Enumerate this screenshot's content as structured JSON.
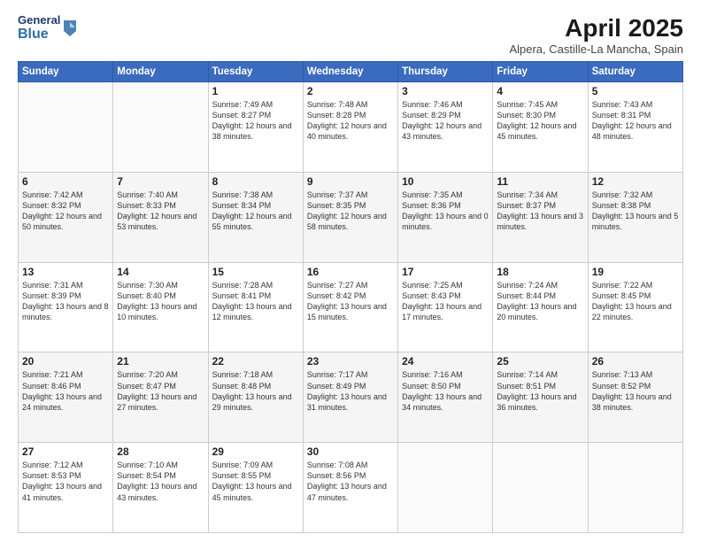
{
  "header": {
    "logo_general": "General",
    "logo_blue": "Blue",
    "month_year": "April 2025",
    "location": "Alpera, Castille-La Mancha, Spain"
  },
  "days_of_week": [
    "Sunday",
    "Monday",
    "Tuesday",
    "Wednesday",
    "Thursday",
    "Friday",
    "Saturday"
  ],
  "weeks": [
    [
      {
        "day": "",
        "info": ""
      },
      {
        "day": "",
        "info": ""
      },
      {
        "day": "1",
        "info": "Sunrise: 7:49 AM\nSunset: 8:27 PM\nDaylight: 12 hours and 38 minutes."
      },
      {
        "day": "2",
        "info": "Sunrise: 7:48 AM\nSunset: 8:28 PM\nDaylight: 12 hours and 40 minutes."
      },
      {
        "day": "3",
        "info": "Sunrise: 7:46 AM\nSunset: 8:29 PM\nDaylight: 12 hours and 43 minutes."
      },
      {
        "day": "4",
        "info": "Sunrise: 7:45 AM\nSunset: 8:30 PM\nDaylight: 12 hours and 45 minutes."
      },
      {
        "day": "5",
        "info": "Sunrise: 7:43 AM\nSunset: 8:31 PM\nDaylight: 12 hours and 48 minutes."
      }
    ],
    [
      {
        "day": "6",
        "info": "Sunrise: 7:42 AM\nSunset: 8:32 PM\nDaylight: 12 hours and 50 minutes."
      },
      {
        "day": "7",
        "info": "Sunrise: 7:40 AM\nSunset: 8:33 PM\nDaylight: 12 hours and 53 minutes."
      },
      {
        "day": "8",
        "info": "Sunrise: 7:38 AM\nSunset: 8:34 PM\nDaylight: 12 hours and 55 minutes."
      },
      {
        "day": "9",
        "info": "Sunrise: 7:37 AM\nSunset: 8:35 PM\nDaylight: 12 hours and 58 minutes."
      },
      {
        "day": "10",
        "info": "Sunrise: 7:35 AM\nSunset: 8:36 PM\nDaylight: 13 hours and 0 minutes."
      },
      {
        "day": "11",
        "info": "Sunrise: 7:34 AM\nSunset: 8:37 PM\nDaylight: 13 hours and 3 minutes."
      },
      {
        "day": "12",
        "info": "Sunrise: 7:32 AM\nSunset: 8:38 PM\nDaylight: 13 hours and 5 minutes."
      }
    ],
    [
      {
        "day": "13",
        "info": "Sunrise: 7:31 AM\nSunset: 8:39 PM\nDaylight: 13 hours and 8 minutes."
      },
      {
        "day": "14",
        "info": "Sunrise: 7:30 AM\nSunset: 8:40 PM\nDaylight: 13 hours and 10 minutes."
      },
      {
        "day": "15",
        "info": "Sunrise: 7:28 AM\nSunset: 8:41 PM\nDaylight: 13 hours and 12 minutes."
      },
      {
        "day": "16",
        "info": "Sunrise: 7:27 AM\nSunset: 8:42 PM\nDaylight: 13 hours and 15 minutes."
      },
      {
        "day": "17",
        "info": "Sunrise: 7:25 AM\nSunset: 8:43 PM\nDaylight: 13 hours and 17 minutes."
      },
      {
        "day": "18",
        "info": "Sunrise: 7:24 AM\nSunset: 8:44 PM\nDaylight: 13 hours and 20 minutes."
      },
      {
        "day": "19",
        "info": "Sunrise: 7:22 AM\nSunset: 8:45 PM\nDaylight: 13 hours and 22 minutes."
      }
    ],
    [
      {
        "day": "20",
        "info": "Sunrise: 7:21 AM\nSunset: 8:46 PM\nDaylight: 13 hours and 24 minutes."
      },
      {
        "day": "21",
        "info": "Sunrise: 7:20 AM\nSunset: 8:47 PM\nDaylight: 13 hours and 27 minutes."
      },
      {
        "day": "22",
        "info": "Sunrise: 7:18 AM\nSunset: 8:48 PM\nDaylight: 13 hours and 29 minutes."
      },
      {
        "day": "23",
        "info": "Sunrise: 7:17 AM\nSunset: 8:49 PM\nDaylight: 13 hours and 31 minutes."
      },
      {
        "day": "24",
        "info": "Sunrise: 7:16 AM\nSunset: 8:50 PM\nDaylight: 13 hours and 34 minutes."
      },
      {
        "day": "25",
        "info": "Sunrise: 7:14 AM\nSunset: 8:51 PM\nDaylight: 13 hours and 36 minutes."
      },
      {
        "day": "26",
        "info": "Sunrise: 7:13 AM\nSunset: 8:52 PM\nDaylight: 13 hours and 38 minutes."
      }
    ],
    [
      {
        "day": "27",
        "info": "Sunrise: 7:12 AM\nSunset: 8:53 PM\nDaylight: 13 hours and 41 minutes."
      },
      {
        "day": "28",
        "info": "Sunrise: 7:10 AM\nSunset: 8:54 PM\nDaylight: 13 hours and 43 minutes."
      },
      {
        "day": "29",
        "info": "Sunrise: 7:09 AM\nSunset: 8:55 PM\nDaylight: 13 hours and 45 minutes."
      },
      {
        "day": "30",
        "info": "Sunrise: 7:08 AM\nSunset: 8:56 PM\nDaylight: 13 hours and 47 minutes."
      },
      {
        "day": "",
        "info": ""
      },
      {
        "day": "",
        "info": ""
      },
      {
        "day": "",
        "info": ""
      }
    ]
  ]
}
